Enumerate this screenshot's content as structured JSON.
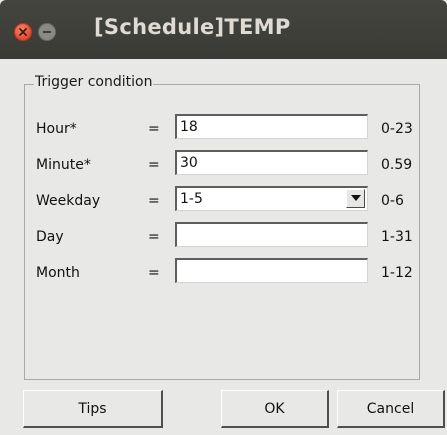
{
  "window": {
    "title": "[Schedule]TEMP",
    "close_icon": "close-icon",
    "minimize_icon": "minimize-icon"
  },
  "group": {
    "legend": "Trigger condition"
  },
  "fields": [
    {
      "label": "Hour*",
      "eq": "=",
      "value": "18",
      "range": "0-23",
      "type": "text"
    },
    {
      "label": "Minute*",
      "eq": "=",
      "value": "30",
      "range": "0.59",
      "type": "text"
    },
    {
      "label": "Weekday",
      "eq": "=",
      "value": "1-5",
      "range": "0-6",
      "type": "combo"
    },
    {
      "label": "Day",
      "eq": "=",
      "value": "",
      "range": "1-31",
      "type": "text"
    },
    {
      "label": "Month",
      "eq": "=",
      "value": "",
      "range": "1-12",
      "type": "text"
    }
  ],
  "buttons": {
    "tips": "Tips",
    "ok": "OK",
    "cancel": "Cancel"
  },
  "colors": {
    "titlebar": "#3f3f3b",
    "close": "#e2492d",
    "dialog_bg": "#e8e8e7"
  }
}
